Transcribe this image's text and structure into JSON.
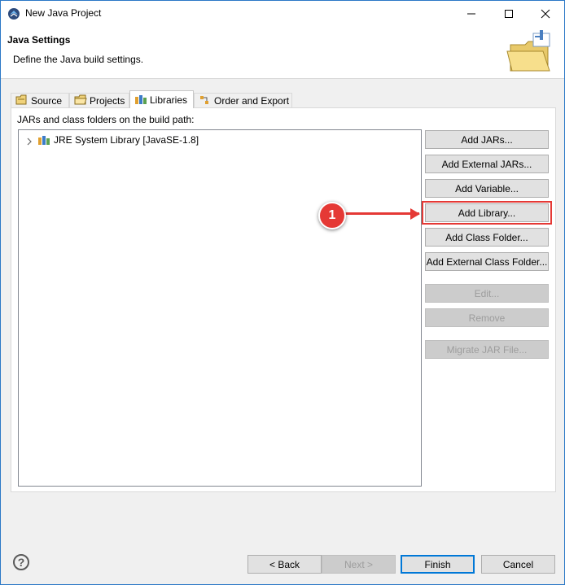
{
  "window": {
    "title": "New Java Project",
    "title_icon": "eclipse-icon",
    "controls": [
      "minimize-icon",
      "maximize-icon",
      "close-icon"
    ]
  },
  "header": {
    "title": "Java Settings",
    "subtitle": "Define the Java build settings.",
    "icon": "java-project-folder-icon"
  },
  "tabs": [
    {
      "label": "Source",
      "icon": "source-folder-icon",
      "active": false
    },
    {
      "label": "Projects",
      "icon": "projects-folder-icon",
      "active": false
    },
    {
      "label": "Libraries",
      "icon": "libraries-icon",
      "active": true
    },
    {
      "label": "Order and Export",
      "icon": "order-export-icon",
      "active": false
    }
  ],
  "libraries": {
    "label": "JARs and class folders on the build path:",
    "tree": [
      {
        "label": "JRE System Library [JavaSE-1.8]",
        "icon": "library-icon",
        "expanded": false
      }
    ]
  },
  "buttons": {
    "add_jars": "Add JARs...",
    "add_external_jars": "Add External JARs...",
    "add_variable": "Add Variable...",
    "add_library": "Add Library...",
    "add_class_folder": "Add Class Folder...",
    "add_external_class_folder": "Add External Class Folder...",
    "edit": "Edit...",
    "remove": "Remove",
    "migrate_jar": "Migrate JAR File..."
  },
  "annotation": {
    "badge": "1",
    "color": "#e53935"
  },
  "footer": {
    "help_icon": "help-icon",
    "back": "< Back",
    "next": "Next >",
    "finish": "Finish",
    "cancel": "Cancel"
  },
  "colors": {
    "window_border": "#2b78c6",
    "dialog_bg": "#f0f0f0",
    "button_bg": "#e1e1e1",
    "default_button_border": "#0078d7",
    "callout": "#e53935"
  }
}
